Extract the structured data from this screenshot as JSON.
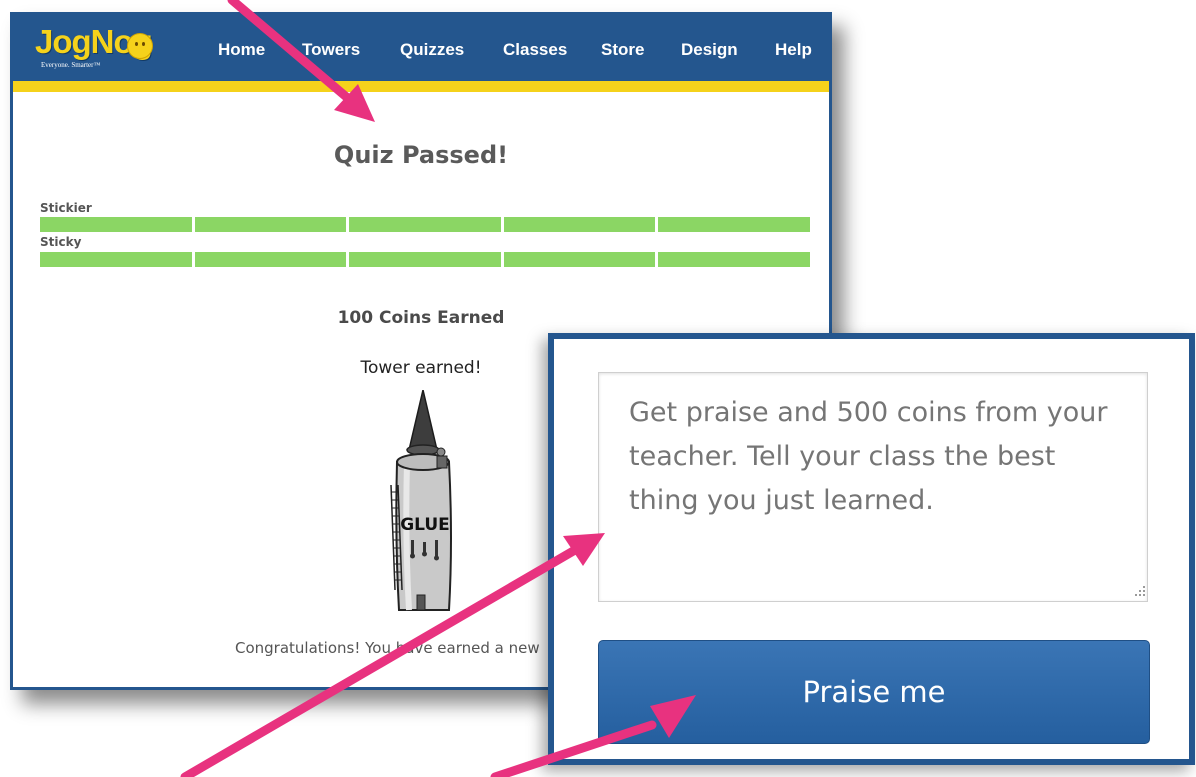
{
  "brand": {
    "logo_text": "JogNog",
    "tagline": "Everyone. Smarter™"
  },
  "nav": {
    "items": [
      "Home",
      "Towers",
      "Quizzes",
      "Classes",
      "Store",
      "Design",
      "Help"
    ]
  },
  "result": {
    "title": "Quiz Passed!",
    "bars": [
      {
        "label": "Stickier",
        "segments": 5,
        "filled": 5
      },
      {
        "label": "Sticky",
        "segments": 5,
        "filled": 5
      }
    ],
    "coins": "100 Coins Earned",
    "tower_earned": "Tower earned!",
    "tower_sign": "GLUE",
    "congrats": "Congratulations! You have earned a new"
  },
  "praise_panel": {
    "placeholder": "Get praise and 500 coins from your teacher. Tell your class the best thing you just learned.",
    "button_label": "Praise me"
  },
  "colors": {
    "brand_blue": "#24568e",
    "accent_yellow": "#f5d21b",
    "progress_green": "#8bd664",
    "arrow_pink": "#e8327f"
  }
}
